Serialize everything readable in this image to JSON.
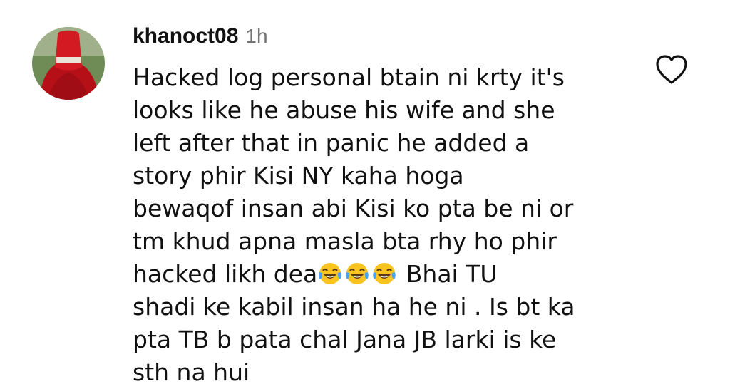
{
  "comment": {
    "username": "khanoct08",
    "timestamp": "1h",
    "lines": [
      "Hacked log personal btain ni krty it's",
      "looks like he abuse his wife and she",
      "left after that in panic he added a",
      "story phir Kisi NY kaha hoga",
      "bewaqof insan abi Kisi ko pta be ni or",
      "tm khud apna masla bta rhy ho phir",
      "hacked likh dea",
      "Bhai TU",
      "shadi ke kabil insan ha he ni . Is bt ka",
      "pta TB b pata chal Jana JB larki is ke",
      "sth na hui"
    ],
    "emojis": [
      "face-with-tears-of-joy-icon",
      "face-with-tears-of-joy-icon",
      "face-with-tears-of-joy-icon"
    ],
    "like_icon": "heart-outline-icon",
    "avatar_icon": "profile-avatar"
  },
  "colors": {
    "text": "#111111",
    "muted": "#737373",
    "avatar_red": "#c8171f",
    "emoji_yellow": "#f9c41e",
    "emoji_tear": "#4aa3ee"
  }
}
